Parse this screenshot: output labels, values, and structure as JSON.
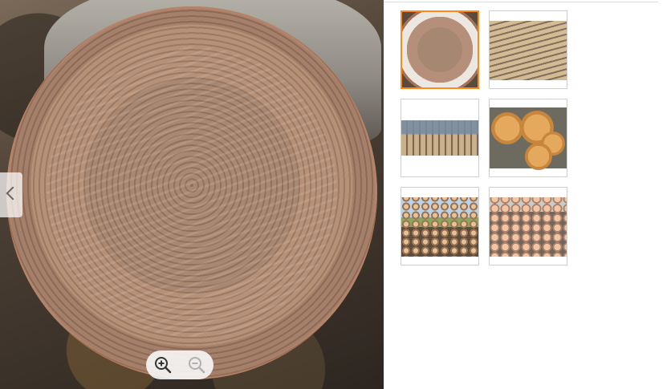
{
  "gallery": {
    "main_image": {
      "icon": "log-cross-section-photo"
    },
    "zoom": {
      "zoom_in_icon": "zoom-in-icon",
      "zoom_out_icon": "zoom-out-icon"
    },
    "thumbnails": [
      {
        "icon": "log-cross-section-thumbnail",
        "selected": true
      },
      {
        "icon": "long-logs-thumbnail",
        "selected": false
      },
      {
        "icon": "log-pile-field-thumbnail",
        "selected": false
      },
      {
        "icon": "cut-log-rounds-thumbnail",
        "selected": false
      },
      {
        "icon": "log-stack-sky-thumbnail",
        "selected": false
      },
      {
        "icon": "log-stack-ground-thumbnail",
        "selected": false
      }
    ]
  },
  "colors": {
    "accent": "#ff8a1c",
    "thumbnail_border": "#cfcfcf"
  }
}
